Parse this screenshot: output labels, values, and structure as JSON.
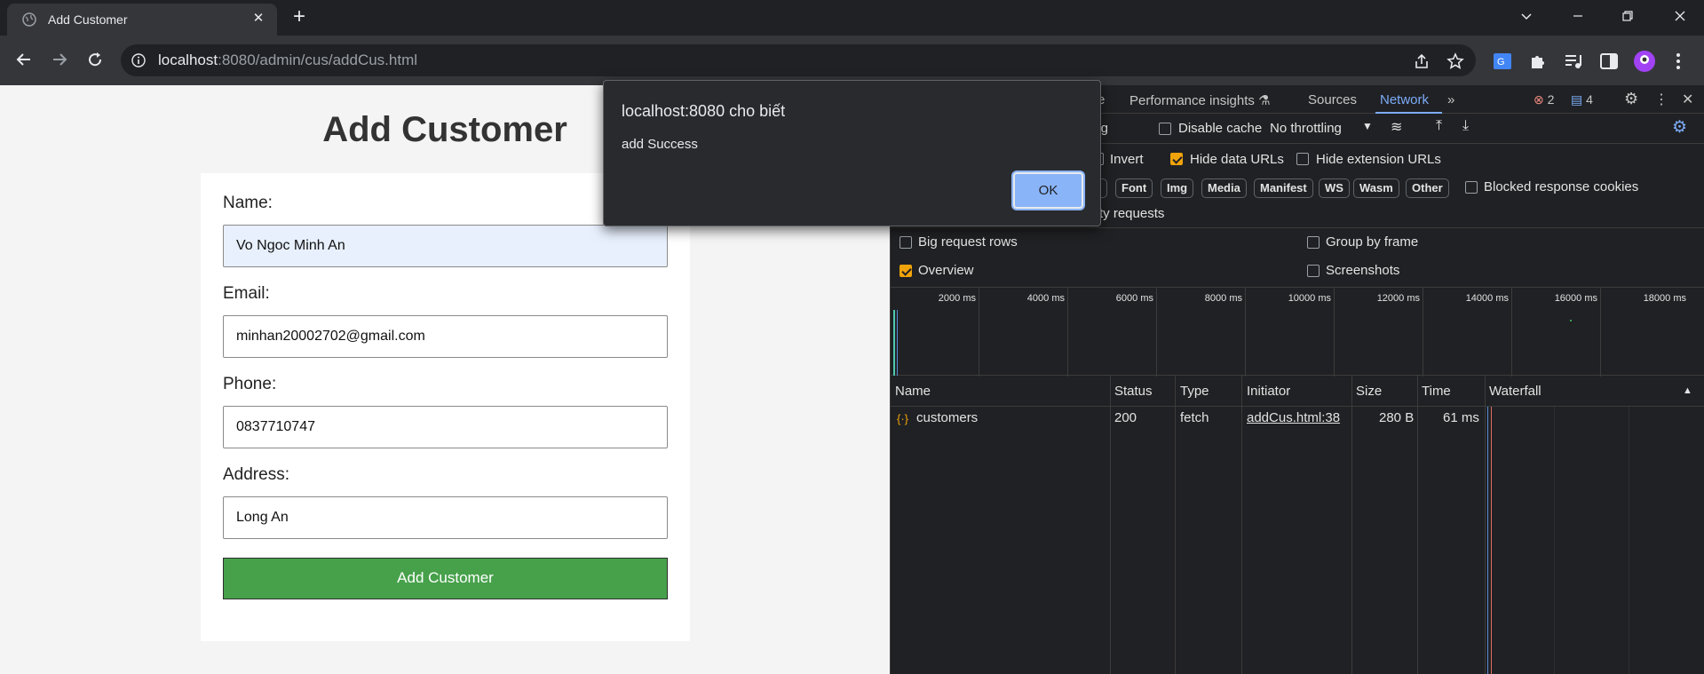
{
  "browser": {
    "tab_title": "Add Customer",
    "url_host": "localhost",
    "url_rest": ":8080/admin/cus/addCus.html"
  },
  "page": {
    "title": "Add Customer",
    "fields": [
      {
        "label": "Name:",
        "value": "Vo Ngoc Minh An"
      },
      {
        "label": "Email:",
        "value": "minhan20002702@gmail.com"
      },
      {
        "label": "Phone:",
        "value": "0837710747"
      },
      {
        "label": "Address:",
        "value": "Long An"
      }
    ],
    "submit_label": "Add Customer",
    "colors": {
      "submit": "#47a14b",
      "autofill": "#e8f0fe"
    }
  },
  "alert": {
    "title": "localhost:8080 cho biết",
    "message": "add Success",
    "ok_label": "OK"
  },
  "devtools": {
    "tabs": [
      "e",
      "Performance insights",
      "Sources",
      "Network"
    ],
    "active_tab": "Network",
    "error_count": "2",
    "message_count": "4",
    "toolbar": {
      "preserve_log": "ve log",
      "disable_cache": "Disable cache",
      "throttling": "No throttling"
    },
    "filters": {
      "invert": "Invert",
      "hide_data_urls": "Hide data URLs",
      "hide_extension_urls": "Hide extension URLs",
      "types": [
        "S",
        "Font",
        "Img",
        "Media",
        "Manifest",
        "WS",
        "Wasm",
        "Other"
      ],
      "blocked_cookies": "Blocked response cookies",
      "third_party": "ty requests"
    },
    "options": {
      "big_request_rows": "Big request rows",
      "group_by_frame": "Group by frame",
      "overview": "Overview",
      "screenshots": "Screenshots"
    },
    "timeline_ticks": [
      "2000 ms",
      "4000 ms",
      "6000 ms",
      "8000 ms",
      "10000 ms",
      "12000 ms",
      "14000 ms",
      "16000 ms",
      "18000 ms"
    ],
    "columns": [
      "Name",
      "Status",
      "Type",
      "Initiator",
      "Size",
      "Time",
      "Waterfall"
    ],
    "rows": [
      {
        "name": "customers",
        "status": "200",
        "type": "fetch",
        "initiator": "addCus.html:38",
        "size": "280 B",
        "time": "61 ms"
      }
    ]
  }
}
